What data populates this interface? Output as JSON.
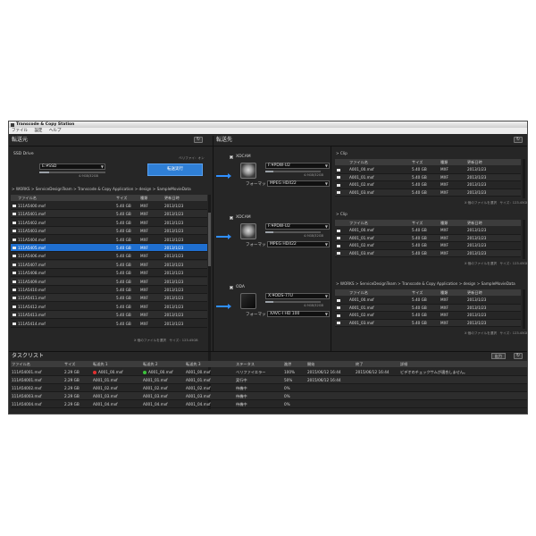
{
  "window": {
    "title": "Transcode & Copy Station"
  },
  "menu": [
    "ファイル",
    "設定",
    "ヘルプ"
  ],
  "source": {
    "header": "転送元",
    "drive_label": "SSD Drive",
    "drive_value": "E:¥SSD",
    "drive_capacity": "4.9GB/32GB",
    "drive_fill": 0.15,
    "transfer_button": "転送実行",
    "verify_label": "ベリファイ：オン",
    "path": "> WORKS > ServiceDesignTeam > Transcode & Copy Application > design > SampleMovieData",
    "columns": [
      "ファイル名",
      "サイズ",
      "種類",
      "更新日時"
    ],
    "files": [
      [
        "111A5400.mxf",
        "5.40 GB",
        "MXF",
        "2013/1/23"
      ],
      [
        "111A5401.mxf",
        "5.40 GB",
        "MXF",
        "2013/1/23"
      ],
      [
        "111A5402.mxf",
        "5.40 GB",
        "MXF",
        "2013/1/23"
      ],
      [
        "111A5403.mxf",
        "5.40 GB",
        "MXF",
        "2013/1/23"
      ],
      [
        "111A5404.mxf",
        "5.40 GB",
        "MXF",
        "2013/1/23"
      ],
      [
        "111A5405.mxf",
        "5.40 GB",
        "MXF",
        "2013/1/23"
      ],
      [
        "111A5406.mxf",
        "5.40 GB",
        "MXF",
        "2013/1/23"
      ],
      [
        "111A5407.mxf",
        "5.40 GB",
        "MXF",
        "2013/1/23"
      ],
      [
        "111A5408.mxf",
        "5.40 GB",
        "MXF",
        "2013/1/23"
      ],
      [
        "111A5409.mxf",
        "5.40 GB",
        "MXF",
        "2013/1/23"
      ],
      [
        "111A5410.mxf",
        "5.40 GB",
        "MXF",
        "2013/1/23"
      ],
      [
        "111A5411.mxf",
        "5.40 GB",
        "MXF",
        "2013/1/23"
      ],
      [
        "111A5412.mxf",
        "5.40 GB",
        "MXF",
        "2013/1/23"
      ],
      [
        "111A5413.mxf",
        "5.40 GB",
        "MXF",
        "2013/1/23"
      ],
      [
        "111A5414.mxf",
        "5.40 GB",
        "MXF",
        "2013/1/23"
      ]
    ],
    "selected_index": 5,
    "footer": "X 個のファイルを選択　サイズ：123.45GB"
  },
  "dest": {
    "header": "転送先",
    "format_label": "フォーマット",
    "targets": [
      {
        "type": "XDCAM",
        "drive": "F:¥PDW-U2",
        "capacity": "4.9GB/32GB",
        "fill": 0.15,
        "format": "MPEG HD422",
        "clip_path": "> Clip"
      },
      {
        "type": "XDCAM",
        "drive": "F:¥PDW-U2",
        "capacity": "4.9GB/32GB",
        "fill": 0.15,
        "format": "MPEG HD422",
        "clip_path": "> Clip"
      },
      {
        "type": "ODA",
        "drive": "X:¥ODS-77U",
        "capacity": "4.9GB/32GB",
        "fill": 0.15,
        "format": "XAVC-I HD 100",
        "clip_path": "> WORKS > ServiceDesignTeam > Transcode & Copy Application > design > SampleMovieData"
      }
    ],
    "columns": [
      "ファイル名",
      "サイズ",
      "種類",
      "更新日時"
    ],
    "files": [
      [
        "A001_00.mxf",
        "5.40 GB",
        "MXF",
        "2013/1/23"
      ],
      [
        "A001_01.mxf",
        "5.40 GB",
        "MXF",
        "2013/1/23"
      ],
      [
        "A001_02.mxf",
        "5.40 GB",
        "MXF",
        "2013/1/23"
      ],
      [
        "A001_03.mxf",
        "5.40 GB",
        "MXF",
        "2013/1/23"
      ]
    ],
    "footer": "X 個のファイルを選択　サイズ：123.45GB"
  },
  "tasks": {
    "header": "タスクリスト",
    "output_button": "出力",
    "columns": [
      "ファイル名",
      "サイズ",
      "転送先 1",
      "転送先 2",
      "転送先 3",
      "ステータス",
      "進捗",
      "開始",
      "終了",
      "詳細"
    ],
    "rows": [
      [
        "111A54001.mxf",
        "2.29 GB",
        "A001_00.mxf",
        "A001_00.mxf",
        "A001_00.mxf",
        "ベリファイエラー",
        "100%",
        "2015/06/12 16:44",
        "2015/06/12 16:44",
        "ビデオのチェックサムが適合しません。"
      ],
      [
        "111A54001.mxf",
        "2.29 GB",
        "A001_01.mxf",
        "A001_01.mxf",
        "A001_01.mxf",
        "実行中",
        "50%",
        "2015/06/12 16:44",
        "",
        ""
      ],
      [
        "111A54002.mxf",
        "2.29 GB",
        "A001_02.mxf",
        "A001_02.mxf",
        "A001_02.mxf",
        "待機中",
        "0%",
        "",
        "",
        ""
      ],
      [
        "111A54003.mxf",
        "2.29 GB",
        "A001_03.mxf",
        "A001_03.mxf",
        "A001_03.mxf",
        "待機中",
        "0%",
        "",
        "",
        ""
      ],
      [
        "111A54004.mxf",
        "2.29 GB",
        "A001_04.mxf",
        "A001_04.mxf",
        "A001_04.mxf",
        "待機中",
        "0%",
        "",
        "",
        ""
      ]
    ]
  },
  "colors": {
    "accent": "#2f7fd6",
    "selection": "#1f6fd0",
    "error_dot": "#e03030",
    "ok_dot": "#3cc23c"
  }
}
